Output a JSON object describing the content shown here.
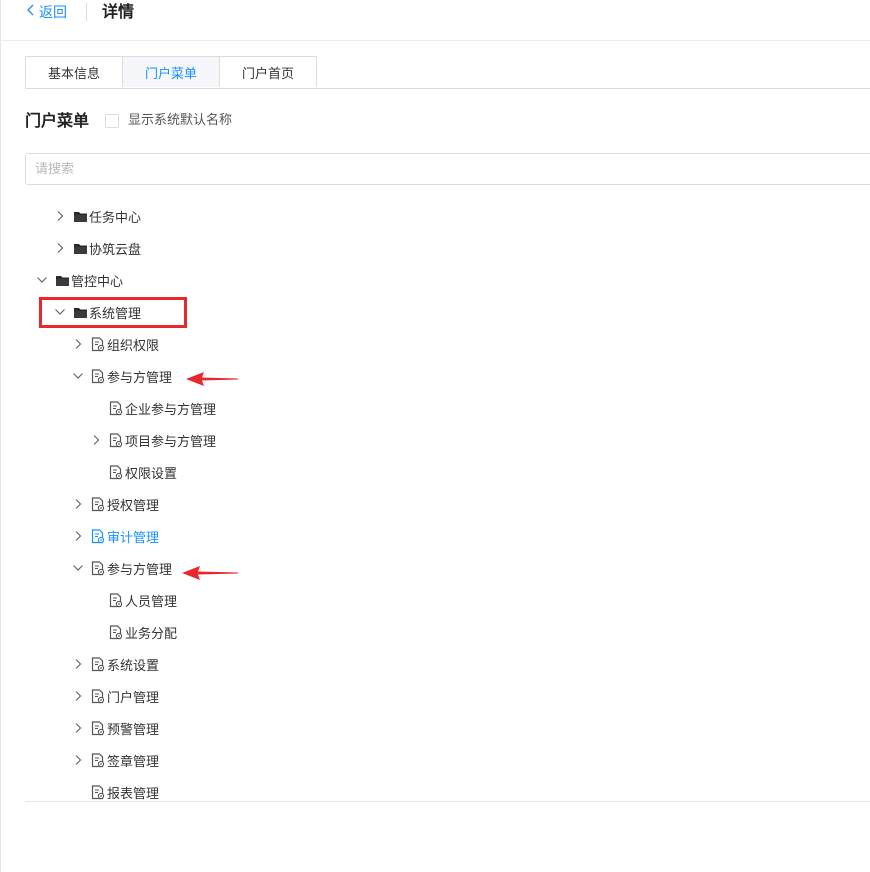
{
  "header": {
    "back_label": "返回",
    "title": "详情"
  },
  "tabs": [
    {
      "label": "基本信息",
      "active": false
    },
    {
      "label": "门户菜单",
      "active": true
    },
    {
      "label": "门户首页",
      "active": false
    }
  ],
  "section": {
    "title": "门户菜单",
    "checkbox_label": "显示系统默认名称",
    "checked": false
  },
  "search": {
    "placeholder": "请搜索",
    "value": ""
  },
  "tree": [
    {
      "label": "任务中心",
      "icon": "folder-icon",
      "caret": "collapsed"
    },
    {
      "label": "协筑云盘",
      "icon": "folder-icon",
      "caret": "collapsed"
    },
    {
      "label": "管控中心",
      "icon": "folder-icon",
      "caret": "expanded"
    },
    {
      "label": "系统管理",
      "icon": "folder-icon",
      "caret": "expanded"
    },
    {
      "label": "组织权限",
      "icon": "page-icon",
      "caret": "collapsed"
    },
    {
      "label": "参与方管理",
      "icon": "page-icon",
      "caret": "expanded"
    },
    {
      "label": "企业参与方管理",
      "icon": "page-icon",
      "caret": "none"
    },
    {
      "label": "项目参与方管理",
      "icon": "page-icon",
      "caret": "collapsed"
    },
    {
      "label": "权限设置",
      "icon": "page-icon",
      "caret": "none"
    },
    {
      "label": "授权管理",
      "icon": "page-icon",
      "caret": "collapsed"
    },
    {
      "label": "审计管理",
      "icon": "page-icon",
      "caret": "collapsed",
      "selected": true
    },
    {
      "label": "参与方管理",
      "icon": "page-icon",
      "caret": "expanded"
    },
    {
      "label": "人员管理",
      "icon": "page-icon",
      "caret": "none"
    },
    {
      "label": "业务分配",
      "icon": "page-icon",
      "caret": "none"
    },
    {
      "label": "系统设置",
      "icon": "page-icon",
      "caret": "collapsed"
    },
    {
      "label": "门户管理",
      "icon": "page-icon",
      "caret": "collapsed"
    },
    {
      "label": "预警管理",
      "icon": "page-icon",
      "caret": "collapsed"
    },
    {
      "label": "签章管理",
      "icon": "page-icon",
      "caret": "collapsed"
    },
    {
      "label": "报表管理",
      "icon": "page-icon",
      "caret": "none"
    }
  ],
  "colors": {
    "accent": "#1890ff",
    "annotation": "#e8282b"
  }
}
